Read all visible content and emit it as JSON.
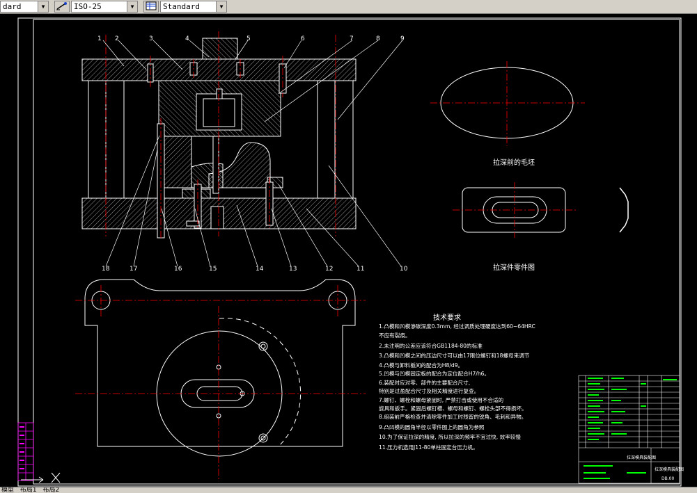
{
  "toolbar": {
    "layer_value": "dard",
    "dimstyle_value": "ISO-25",
    "textstyle_value": "Standard"
  },
  "drawing": {
    "part_numbers": [
      "1",
      "2",
      "3",
      "4",
      "5",
      "6",
      "7",
      "8",
      "9",
      "10",
      "11",
      "12",
      "13",
      "14",
      "15",
      "16",
      "17",
      "18"
    ],
    "label_blank": "拉深前的毛坯",
    "label_part": "拉深件零件图",
    "tech_title": "技术要求",
    "tech_lines": [
      "1.凸模和凹模渗碳深度0.3mm, 经过调质处理硬度达到60~64HRC",
      "  不应有裂痕。",
      "2.未注明的公差应该符合GB1184-80的标准",
      "3.凸模和凹模之间的压边尺寸可以由17限位螺钉和18螺母来调节",
      "4.凸模与卸料板间的配合为H8/d9。",
      "5.凹模与凹模固定板的配合为定位配合H7/h6。",
      "6.装配时应对零、部件的主要配合尺寸,",
      "  特别是过盈配合尺寸及相关精度进行复查。",
      "7.螺钉、螺栓和螺母紧固时, 严禁打击或使用不合适的",
      "  旋具和扳手。紧固后螺钉槽、螺母和螺钉、螺栓头部不得损坏。",
      "8.组装前严格检查并清除零件加工时残留的锐角、毛刺和异物。",
      "9.凸凹模的圆角半径以零件图上的圆角为参照",
      "10.为了保证拉深的精度, 所以拉深的频率不宜过快, 效率较慢",
      "11.压力机选用J11-80单柱固定台压力机。"
    ],
    "title_block": "拉深模具装配图",
    "drawing_no": "DB.00"
  },
  "status": {
    "items": [
      "模型",
      "布局1",
      "布局2"
    ]
  },
  "colors": {
    "background": "#000000",
    "geometry": "#ffffff",
    "centerline": "#ff0000",
    "leader": "#ffffff",
    "table_accent": "#00ff00",
    "left_table": "#ff00ff"
  }
}
